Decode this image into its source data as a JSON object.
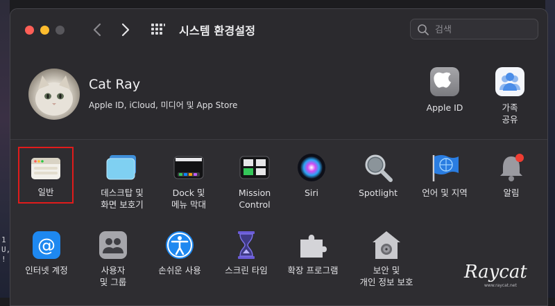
{
  "window": {
    "title": "시스템 환경설정"
  },
  "search": {
    "placeholder": "검색"
  },
  "account": {
    "name": "Cat Ray",
    "subtitle": "Apple ID, iCloud, 미디어 및 App Store"
  },
  "top_panes": [
    {
      "label": "Apple ID",
      "icon": "apple-logo-icon"
    },
    {
      "label": "가족\n공유",
      "icon": "family-sharing-icon"
    }
  ],
  "panes_row1": [
    {
      "label": "일반",
      "icon": "general-icon",
      "selected": true
    },
    {
      "label": "데스크탑 및\n화면 보호기",
      "icon": "desktop-screensaver-icon"
    },
    {
      "label": "Dock 및\n메뉴 막대",
      "icon": "dock-icon"
    },
    {
      "label": "Mission\nControl",
      "icon": "mission-control-icon"
    },
    {
      "label": "Siri",
      "icon": "siri-icon"
    },
    {
      "label": "Spotlight",
      "icon": "spotlight-icon"
    },
    {
      "label": "언어 및 지역",
      "icon": "language-region-icon"
    },
    {
      "label": "알림",
      "icon": "notifications-icon"
    }
  ],
  "panes_row2": [
    {
      "label": "인터넷 계정",
      "icon": "internet-accounts-icon"
    },
    {
      "label": "사용자\n및 그룹",
      "icon": "users-groups-icon"
    },
    {
      "label": "손쉬운 사용",
      "icon": "accessibility-icon"
    },
    {
      "label": "스크린 타임",
      "icon": "screen-time-icon"
    },
    {
      "label": "확장 프로그램",
      "icon": "extensions-icon"
    },
    {
      "label": "보안 및\n개인 정보 보호",
      "icon": "security-privacy-icon"
    }
  ],
  "desktop_left_text": "1\nU,\n!",
  "watermark": {
    "text": "Raycat",
    "sub": "www.raycat.net"
  },
  "colors": {
    "close": "#ff5f57",
    "minimize": "#febc2e",
    "selection_outline": "#e11b1b",
    "window_bg": "#2b2a2e",
    "accent_blue": "#1e88f0"
  }
}
